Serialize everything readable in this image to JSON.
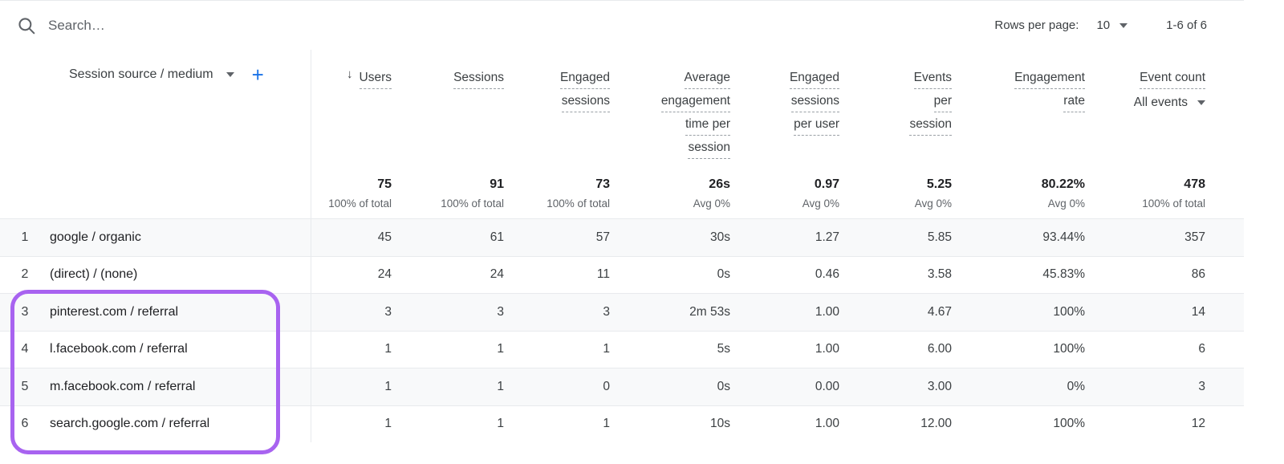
{
  "search": {
    "placeholder": "Search…",
    "value": "",
    "icon": "search-icon"
  },
  "pagination": {
    "rows_per_page_label": "Rows per page:",
    "rows_per_page_value": "10",
    "range": "1-6 of 6",
    "dropdown_icon": "chevron-down-icon"
  },
  "dimension_header": {
    "label": "Session source / medium",
    "dropdown_icon": "chevron-down-icon",
    "add_icon": "plus-icon"
  },
  "metric_headers": [
    {
      "lines": [
        "Users"
      ],
      "sorted": true,
      "sort_icon": "arrow-down-icon"
    },
    {
      "lines": [
        "Sessions"
      ],
      "sorted": false
    },
    {
      "lines": [
        "Engaged",
        "sessions"
      ],
      "sorted": false
    },
    {
      "lines": [
        "Average",
        "engagement",
        "time per",
        "session"
      ],
      "sorted": false
    },
    {
      "lines": [
        "Engaged",
        "sessions",
        "per user"
      ],
      "sorted": false
    },
    {
      "lines": [
        "Events",
        "per",
        "session"
      ],
      "sorted": false
    },
    {
      "lines": [
        "Engagement",
        "rate"
      ],
      "sorted": false
    },
    {
      "lines": [
        "Event count"
      ],
      "sorted": false,
      "sublabel": "All events",
      "sublabel_icon": "chevron-down-icon"
    }
  ],
  "totals": [
    {
      "value": "75",
      "sub": "100% of total"
    },
    {
      "value": "91",
      "sub": "100% of total"
    },
    {
      "value": "73",
      "sub": "100% of total"
    },
    {
      "value": "26s",
      "sub": "Avg 0%"
    },
    {
      "value": "0.97",
      "sub": "Avg 0%"
    },
    {
      "value": "5.25",
      "sub": "Avg 0%"
    },
    {
      "value": "80.22%",
      "sub": "Avg 0%"
    },
    {
      "value": "478",
      "sub": "100% of total"
    }
  ],
  "rows": [
    {
      "index": "1",
      "dimension": "google / organic",
      "values": [
        "45",
        "61",
        "57",
        "30s",
        "1.27",
        "5.85",
        "93.44%",
        "357"
      ]
    },
    {
      "index": "2",
      "dimension": "(direct) / (none)",
      "values": [
        "24",
        "24",
        "11",
        "0s",
        "0.46",
        "3.58",
        "45.83%",
        "86"
      ]
    },
    {
      "index": "3",
      "dimension": "pinterest.com / referral",
      "values": [
        "3",
        "3",
        "3",
        "2m 53s",
        "1.00",
        "4.67",
        "100%",
        "14"
      ]
    },
    {
      "index": "4",
      "dimension": "l.facebook.com / referral",
      "values": [
        "1",
        "1",
        "1",
        "5s",
        "1.00",
        "6.00",
        "100%",
        "6"
      ]
    },
    {
      "index": "5",
      "dimension": "m.facebook.com / referral",
      "values": [
        "1",
        "1",
        "0",
        "0s",
        "0.00",
        "3.00",
        "0%",
        "3"
      ]
    },
    {
      "index": "6",
      "dimension": "search.google.com / referral",
      "values": [
        "1",
        "1",
        "1",
        "10s",
        "1.00",
        "12.00",
        "100%",
        "12"
      ]
    }
  ],
  "annotation": {
    "type": "highlight-box",
    "color": "#a863f0",
    "covers_rows": [
      "3",
      "4",
      "5",
      "6"
    ]
  }
}
